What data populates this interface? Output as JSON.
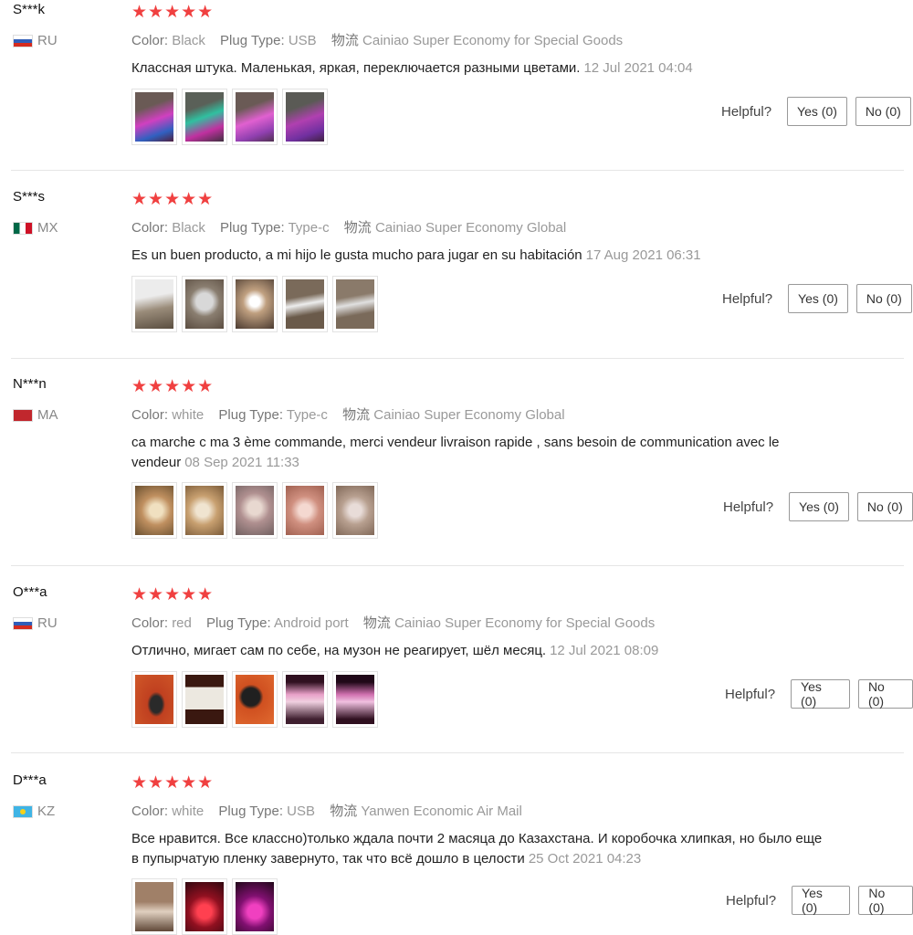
{
  "helpful_label": "Helpful?",
  "reviews": [
    {
      "user": "S***k",
      "country": "RU",
      "stars": "★★★★★",
      "color_label": "Color:",
      "color": "Black",
      "plug_label": "Plug Type:",
      "plug": "USB",
      "ship_label": "物流",
      "ship": "Cainiao Super Economy for Special Goods",
      "comment": "Классная штука. Маленькая, яркая, переключается разными цветами.",
      "date": "12 Jul 2021 04:04",
      "yes": "Yes (0)",
      "no": "No (0)"
    },
    {
      "user": "S***s",
      "country": "MX",
      "stars": "★★★★★",
      "color_label": "Color:",
      "color": "Black",
      "plug_label": "Plug Type:",
      "plug": "Type-c",
      "ship_label": "物流",
      "ship": "Cainiao Super Economy Global",
      "comment": "Es un buen producto, a mi hijo le gusta mucho para jugar en su habitación",
      "date": "17 Aug 2021 06:31",
      "yes": "Yes (0)",
      "no": "No (0)"
    },
    {
      "user": "N***n",
      "country": "MA",
      "stars": "★★★★★",
      "color_label": "Color:",
      "color": "white",
      "plug_label": "Plug Type:",
      "plug": "Type-c",
      "ship_label": "物流",
      "ship": "Cainiao Super Economy Global",
      "comment": "ca marche c ma 3 ème commande, merci vendeur livraison rapide , sans besoin de communication avec le vendeur",
      "date": "08 Sep 2021 11:33",
      "yes": "Yes (0)",
      "no": "No (0)"
    },
    {
      "user": "O***a",
      "country": "RU",
      "stars": "★★★★★",
      "color_label": "Color:",
      "color": "red",
      "plug_label": "Plug Type:",
      "plug": "Android port",
      "ship_label": "物流",
      "ship": "Cainiao Super Economy for Special Goods",
      "comment": "Отлично, мигает сам по себе, на музон не реагирует, шёл месяц.",
      "date": "12 Jul 2021 08:09",
      "yes": "Yes (0)",
      "no": "No (0)"
    },
    {
      "user": "D***a",
      "country": "KZ",
      "stars": "★★★★★",
      "color_label": "Color:",
      "color": "white",
      "plug_label": "Plug Type:",
      "plug": "USB",
      "ship_label": "物流",
      "ship": "Yanwen Economic Air Mail",
      "comment": "Все нравится. Все классно)только ждала почти 2 масяца до Казахстана. И коробочка хлипкая, но было еще в пупырчатую пленку завернуто, так что всё дошло в целости",
      "date": "25 Oct 2021 04:23",
      "yes": "Yes (0)",
      "no": "No (0)"
    }
  ]
}
